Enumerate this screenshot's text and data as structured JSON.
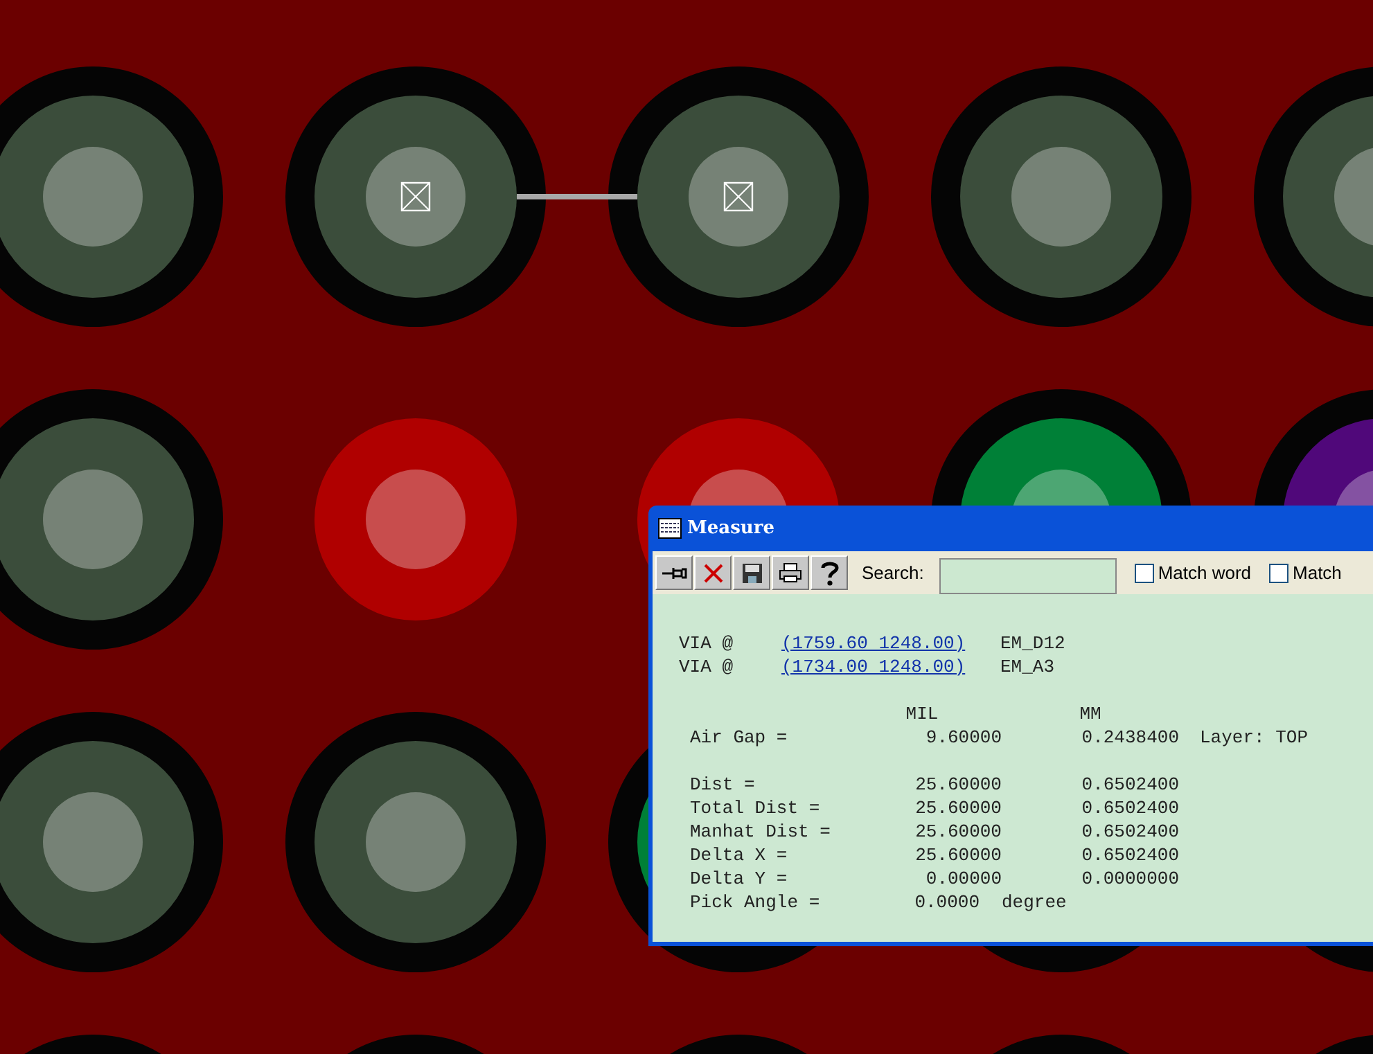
{
  "board": {
    "rows": [
      [
        {
          "kind": "via",
          "color": "#3b4d3b",
          "marked": false
        },
        {
          "kind": "via",
          "color": "#3b4d3b",
          "marked": true
        },
        {
          "kind": "via",
          "color": "#3b4d3b",
          "marked": true
        },
        {
          "kind": "via",
          "color": "#3b4d3b",
          "marked": false
        },
        {
          "kind": "via",
          "color": "#3b4d3b",
          "marked": false
        }
      ],
      [
        {
          "kind": "via",
          "color": "#3b4d3b",
          "marked": false
        },
        {
          "kind": "pad",
          "color": "#b00000",
          "marked": false
        },
        {
          "kind": "pad",
          "color": "#b00000",
          "marked": false
        },
        {
          "kind": "via",
          "color": "#008037",
          "marked": false
        },
        {
          "kind": "via",
          "color": "#50087a",
          "marked": false
        }
      ],
      [
        {
          "kind": "via",
          "color": "#3b4d3b",
          "marked": false
        },
        {
          "kind": "via",
          "color": "#3b4d3b",
          "marked": false
        },
        {
          "kind": "via",
          "color": "#008037"
        },
        {
          "kind": "ring"
        },
        {
          "kind": "ring"
        }
      ],
      [
        {
          "kind": "ring"
        },
        {
          "kind": "ring"
        },
        {
          "kind": "ring"
        },
        {
          "kind": "ring"
        },
        {
          "kind": "ring"
        }
      ]
    ]
  },
  "measure_window": {
    "title": "Measure",
    "toolbar": [
      {
        "kind": "pin"
      },
      {
        "kind": "close"
      },
      {
        "kind": "save"
      },
      {
        "kind": "print"
      },
      {
        "kind": "help"
      }
    ],
    "search": {
      "label": "Search:"
    },
    "options": [
      {
        "label": "Match word",
        "checked": false
      },
      {
        "label": "Match",
        "checked": false
      }
    ],
    "vias": [
      {
        "label": "VIA @",
        "coords": "(1759.60 1248.00)",
        "name": "EM_D12"
      },
      {
        "label": "VIA @",
        "coords": "(1734.00 1248.00)",
        "name": "EM_A3"
      }
    ],
    "columns": [
      "MIL",
      "MM"
    ],
    "air_gap": {
      "label": "Air Gap =",
      "mil": "9.60000",
      "mm": "0.2438400",
      "layer": "Layer: TOP"
    },
    "measurements": [
      {
        "label": "Dist =",
        "mil": "25.60000",
        "mm": "0.6502400"
      },
      {
        "label": "Total Dist =",
        "mil": "25.60000",
        "mm": "0.6502400"
      },
      {
        "label": "Manhat Dist =",
        "mil": "25.60000",
        "mm": "0.6502400"
      },
      {
        "label": "Delta X =",
        "mil": "25.60000",
        "mm": "0.6502400"
      },
      {
        "label": "Delta Y =",
        "mil": "0.00000",
        "mm": "0.0000000"
      }
    ],
    "pick_angle": {
      "label": "Pick Angle =",
      "value": "0.0000",
      "unit": "degree"
    }
  }
}
